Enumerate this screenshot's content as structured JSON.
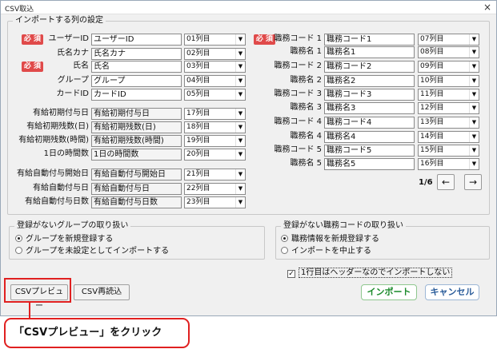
{
  "window": {
    "title": "CSV取込",
    "close": "×"
  },
  "groups": {
    "columns": "インポートする列の設定",
    "groupHandling": "登録がないグループの取り扱い",
    "jobHandling": "登録がない職務コードの取り扱い"
  },
  "required": "必 須",
  "left_rows": [
    {
      "label": "ユーザーID",
      "value": "ユーザーID",
      "col": "01列目",
      "required": true
    },
    {
      "label": "氏名カナ",
      "value": "氏名カナ",
      "col": "02列目",
      "required": false
    },
    {
      "label": "氏名",
      "value": "氏名",
      "col": "03列目",
      "required": true
    },
    {
      "label": "グループ",
      "value": "グループ",
      "col": "04列目",
      "required": false
    },
    {
      "label": "カードID",
      "value": "カードID",
      "col": "05列目",
      "required": false
    },
    {
      "label": "有給初期付与日",
      "value": "有給初期付与日",
      "col": "17列目",
      "required": false
    },
    {
      "label": "有給初期残数(日)",
      "value": "有給初期残数(日)",
      "col": "18列目",
      "required": false
    },
    {
      "label": "有給初期残数(時間)",
      "value": "有給初期残数(時間)",
      "col": "19列目",
      "required": false
    },
    {
      "label": "1日の時間数",
      "value": "1日の時間数",
      "col": "20列目",
      "required": false
    },
    {
      "label": "有給自動付与開始日",
      "value": "有給自動付与開始日",
      "col": "21列目",
      "required": false
    },
    {
      "label": "有給自動付与日",
      "value": "有給自動付与日",
      "col": "22列目",
      "required": false
    },
    {
      "label": "有給自動付与日数",
      "value": "有給自動付与日数",
      "col": "23列目",
      "required": false
    }
  ],
  "right_rows": [
    {
      "label": "職務コード 1",
      "value": "職務コード1",
      "col": "07列目",
      "required": true
    },
    {
      "label": "職務名 1",
      "value": "職務名1",
      "col": "08列目",
      "required": false
    },
    {
      "label": "職務コード 2",
      "value": "職務コード2",
      "col": "09列目",
      "required": false
    },
    {
      "label": "職務名 2",
      "value": "職務名2",
      "col": "10列目",
      "required": false
    },
    {
      "label": "職務コード 3",
      "value": "職務コード3",
      "col": "11列目",
      "required": false
    },
    {
      "label": "職務名 3",
      "value": "職務名3",
      "col": "12列目",
      "required": false
    },
    {
      "label": "職務コード 4",
      "value": "職務コード4",
      "col": "13列目",
      "required": false
    },
    {
      "label": "職務名 4",
      "value": "職務名4",
      "col": "14列目",
      "required": false
    },
    {
      "label": "職務コード 5",
      "value": "職務コード5",
      "col": "15列目",
      "required": false
    },
    {
      "label": "職務名 5",
      "value": "職務名5",
      "col": "16列目",
      "required": false
    }
  ],
  "pager": {
    "text": "1/6",
    "prev": "←",
    "next": "→"
  },
  "group_options": [
    {
      "label": "グループを新規登録する",
      "selected": true
    },
    {
      "label": "グループを未設定としてインポートする",
      "selected": false
    }
  ],
  "job_options": [
    {
      "label": "職務情報を新規登録する",
      "selected": true
    },
    {
      "label": "インポートを中止する",
      "selected": false
    }
  ],
  "header_checkbox": {
    "label": "1行目はヘッダーなのでインポートしない",
    "checked": true,
    "mark": "✓"
  },
  "buttons": {
    "preview": "CSVプレビュー",
    "reread": "CSV再読込",
    "import": "インポート",
    "cancel": "キャンセル"
  },
  "callout": "「CSVプレビュー」をクリック",
  "colors": {
    "required": "#e04a4a",
    "highlight": "#e02020",
    "import": "#1a8a2a",
    "cancel": "#2a5c9a"
  },
  "icons": {
    "dropdown": "▼"
  }
}
